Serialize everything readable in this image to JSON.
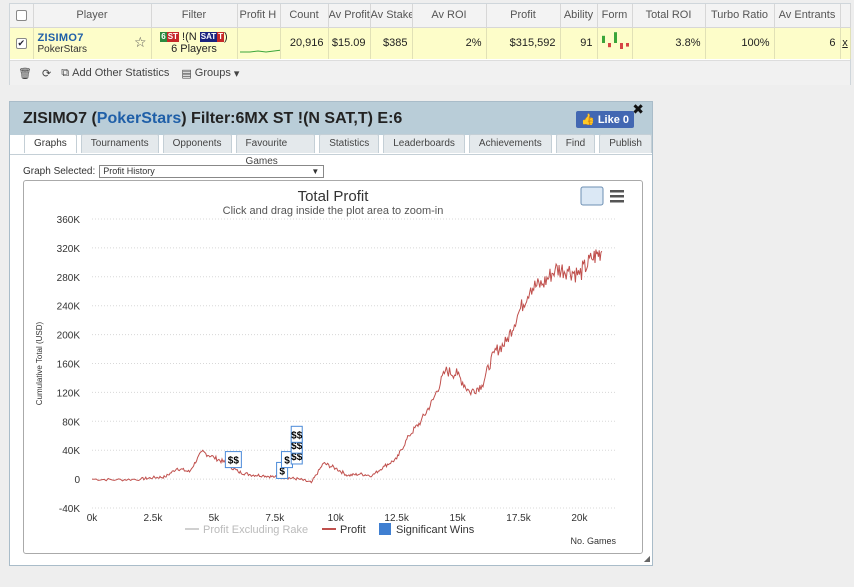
{
  "stats": {
    "headers": [
      "Player",
      "Filter",
      "Profit H",
      "Count",
      "Av Profit",
      "Av Stake",
      "Av ROI",
      "Profit",
      "Ability",
      "Form",
      "Total ROI",
      "Turbo Ratio",
      "Av Entrants"
    ],
    "row": {
      "player": "ZISIMO7",
      "site": "PokerStars",
      "filter_tag1": "6",
      "filter_tag2": "ST",
      "filter_text": "!(N",
      "filter_tag3": "SAT",
      "filter_tag4": "T",
      "filter_text2": ")",
      "filter_players": "6 Players",
      "count": "20,916",
      "av_profit": "$15.09",
      "av_stake": "$385",
      "av_roi": "2%",
      "profit": "$315,592",
      "ability": "91",
      "total_roi": "3.8%",
      "turbo_ratio": "100%",
      "av_entrants": "6",
      "extra": "x"
    },
    "form_bars": [
      {
        "v": 0.6,
        "c": "#3aa53a"
      },
      {
        "v": -0.35,
        "c": "#d64545"
      },
      {
        "v": 0.9,
        "c": "#3aa53a"
      },
      {
        "v": -0.5,
        "c": "#d64545"
      },
      {
        "v": -0.3,
        "c": "#d64545"
      }
    ]
  },
  "toolbar": {
    "add_stats": "Add Other Statistics",
    "groups": "Groups"
  },
  "panel": {
    "title_player": "ZISIMO7 (",
    "title_site": "PokerStars",
    "title_rest": ") Filter:6MX ST !(N SAT,T) E:6",
    "like_label": "Like 0",
    "tabs": [
      "Graphs",
      "Tournaments",
      "Opponents",
      "Favourite Games",
      "Statistics",
      "Leaderboards",
      "Achievements",
      "Find",
      "Publish"
    ],
    "graph_selected_label": "Graph Selected:",
    "graph_selected_value": "Profit History"
  },
  "chart_data": {
    "type": "line",
    "title": "Total Profit",
    "subtitle": "Click and drag inside the plot area to zoom-in",
    "ylabel": "Cumulative Total (USD)",
    "xlabel": "No. Games",
    "ylim": [
      -40000,
      360000
    ],
    "xlim": [
      0,
      21500
    ],
    "y_ticks": [
      "-40K",
      "0",
      "40K",
      "80K",
      "120K",
      "160K",
      "200K",
      "240K",
      "280K",
      "320K",
      "360K"
    ],
    "x_ticks": [
      "0k",
      "2.5k",
      "5k",
      "7.5k",
      "10k",
      "12.5k",
      "15k",
      "17.5k",
      "20k"
    ],
    "grid": true,
    "legend_position": "bottom",
    "legend": [
      "Profit Excluding Rake",
      "Profit",
      "Significant Wins"
    ],
    "series": [
      {
        "name": "Profit",
        "color": "#c0504d",
        "x": [
          0,
          1000,
          2000,
          2500,
          3000,
          3500,
          4000,
          4500,
          5000,
          5500,
          6000,
          6500,
          7000,
          7500,
          8000,
          8500,
          9000,
          9500,
          10000,
          10500,
          11000,
          11500,
          12000,
          12500,
          13000,
          13500,
          14000,
          14500,
          15000,
          15500,
          16000,
          16500,
          17000,
          17500,
          18000,
          18500,
          19000,
          19500,
          20000,
          20500,
          20916
        ],
        "values": [
          0,
          -1000,
          0,
          2000,
          3000,
          15000,
          10000,
          38000,
          30000,
          22000,
          10000,
          6000,
          5000,
          3000,
          2000,
          0,
          -5000,
          22000,
          15000,
          5000,
          7000,
          5000,
          18000,
          28000,
          60000,
          80000,
          110000,
          150000,
          145000,
          120000,
          130000,
          175000,
          190000,
          230000,
          265000,
          270000,
          290000,
          290000,
          283000,
          305000,
          315592
        ]
      }
    ],
    "significant_wins": [
      {
        "x": 5800,
        "label": "$$"
      },
      {
        "x": 7800,
        "label": "$"
      },
      {
        "x": 8000,
        "label": "$"
      },
      {
        "x": 8400,
        "label": "$$"
      }
    ]
  }
}
